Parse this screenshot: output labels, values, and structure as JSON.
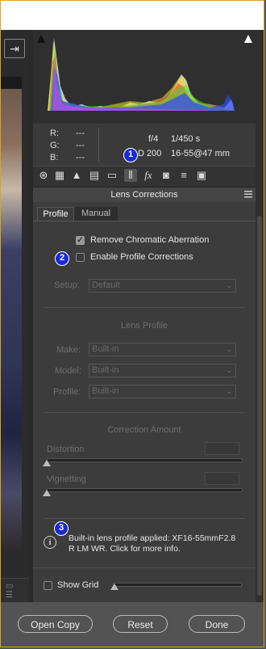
{
  "histogram": {
    "info": {
      "rgb_labels": [
        "R:",
        "G:",
        "B:"
      ],
      "rgb_values": [
        "---",
        "---",
        "---"
      ],
      "aperture": "f/4",
      "shutter": "1/450 s",
      "iso": "ISO 200",
      "iso_visible": "D 200",
      "lens": "16-55@47 mm"
    }
  },
  "panel": {
    "title": "Lens Corrections",
    "tabs": [
      {
        "label": "Profile",
        "selected": true
      },
      {
        "label": "Manual",
        "selected": false
      }
    ],
    "remove_ca": {
      "label": "Remove Chromatic Aberration",
      "checked": true
    },
    "enable_profile": {
      "label": "Enable Profile Corrections",
      "checked": false
    },
    "setup": {
      "label": "Setup:",
      "value": "Default"
    },
    "lens_profile": {
      "title": "Lens Profile",
      "make": {
        "label": "Make:",
        "value": "Built-in"
      },
      "model": {
        "label": "Model:",
        "value": "Built-in"
      },
      "profile": {
        "label": "Profile:",
        "value": "Built-in"
      }
    },
    "correction_amount": {
      "title": "Correction Amount",
      "distortion": {
        "label": "Distortion",
        "value": 0
      },
      "vignetting": {
        "label": "Vignetting",
        "value": 0
      }
    },
    "info_message": "Built-in lens profile applied: XF16-55mmF2.8 R LM WR.  Click for more info.",
    "show_grid": {
      "label": "Show Grid",
      "checked": false,
      "value": 0
    }
  },
  "callouts": [
    "1",
    "2",
    "3"
  ],
  "footer": {
    "open_copy": "Open Copy",
    "reset": "Reset",
    "done": "Done"
  },
  "colors": {
    "callout": "#1c2ad2",
    "frame_border": "#e0a020"
  }
}
